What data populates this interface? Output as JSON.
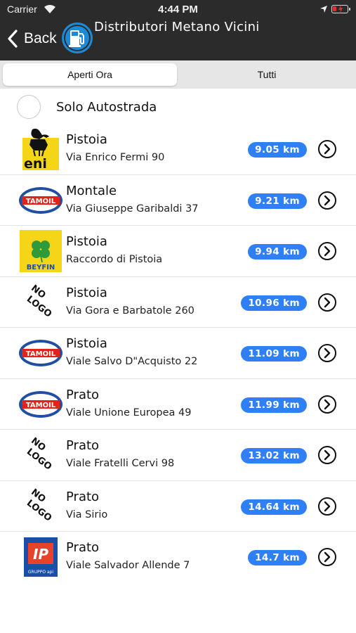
{
  "status_bar": {
    "carrier": "Carrier",
    "time": "4:44 PM"
  },
  "nav": {
    "back_label": "Back",
    "title": "Distributori Metano Vicini"
  },
  "tabs": [
    {
      "label": "Aperti Ora",
      "active": true
    },
    {
      "label": "Tutti",
      "active": false
    }
  ],
  "filter": {
    "label": "Solo Autostrada",
    "checked": false
  },
  "colors": {
    "nav_bg": "#2b2b2b",
    "accent_blue": "#2f7ff6",
    "app_icon_blue": "#1e8ad6"
  },
  "stations": [
    {
      "brand": "eni",
      "city": "Pistoia",
      "address": "Via Enrico Fermi 90",
      "distance": "9.05 km"
    },
    {
      "brand": "tamoil",
      "city": "Montale",
      "address": "Via Giuseppe Garibaldi 37",
      "distance": "9.21 km"
    },
    {
      "brand": "beyfin",
      "city": "Pistoia",
      "address": "Raccordo di Pistoia",
      "distance": "9.94 km"
    },
    {
      "brand": "no-logo",
      "city": "Pistoia",
      "address": "Via Gora e Barbatole 260",
      "distance": "10.96 km"
    },
    {
      "brand": "tamoil",
      "city": "Pistoia",
      "address": "Viale Salvo D\"Acquisto 22",
      "distance": "11.09 km"
    },
    {
      "brand": "tamoil",
      "city": "Prato",
      "address": "Viale Unione Europea 49",
      "distance": "11.99 km"
    },
    {
      "brand": "no-logo",
      "city": "Prato",
      "address": "Viale Fratelli Cervi 98",
      "distance": "13.02 km"
    },
    {
      "brand": "no-logo",
      "city": "Prato",
      "address": "Via Sirio",
      "distance": "14.64 km"
    },
    {
      "brand": "ip",
      "city": "Prato",
      "address": "Viale Salvador Allende 7",
      "distance": "14.7 km"
    }
  ],
  "logo_text": {
    "eni": "eni",
    "tamoil": "TAMOIL",
    "beyfin": "BEYFIN",
    "no_logo_1": "NO",
    "no_logo_2": "LOGO",
    "ip": "IP",
    "ip_sub": "GRUPPO api"
  },
  "icons": {
    "back": "chevron-left-icon",
    "app": "fuel-pump-icon",
    "row_action": "chevron-circle-right-icon",
    "filter": "radio-empty-icon"
  }
}
